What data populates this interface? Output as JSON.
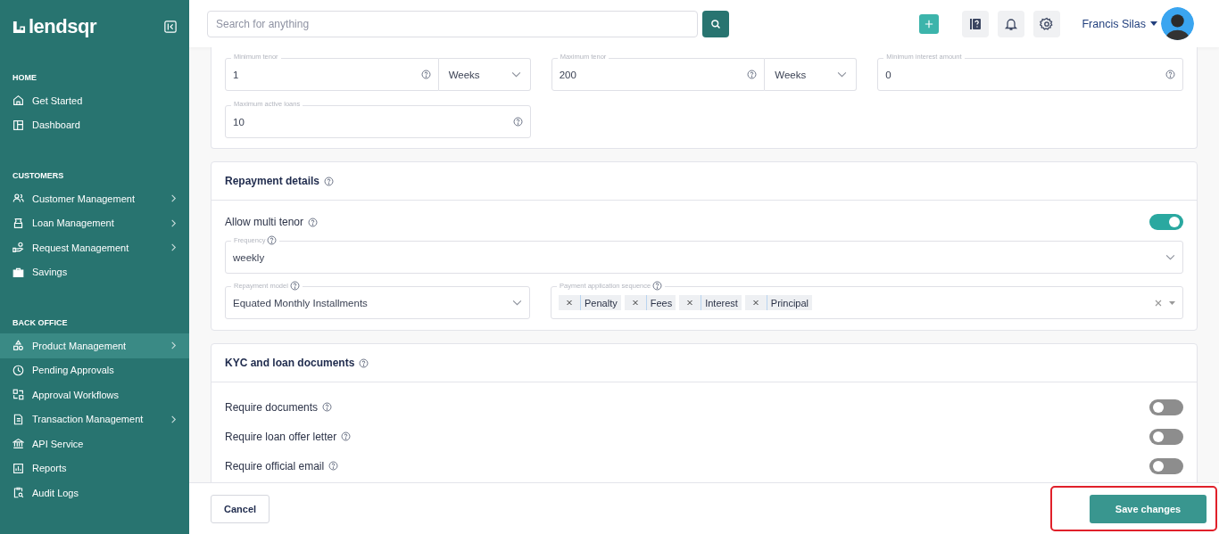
{
  "sidebar": {
    "logo": "lendsqr",
    "sections": [
      {
        "title": "HOME",
        "items": [
          {
            "label": "Get Started",
            "selected": false,
            "submenu": false
          },
          {
            "label": "Dashboard",
            "selected": false,
            "submenu": false
          }
        ]
      },
      {
        "title": "CUSTOMERS",
        "items": [
          {
            "label": "Customer Management",
            "selected": false,
            "submenu": true
          },
          {
            "label": "Loan Management",
            "selected": false,
            "submenu": true
          },
          {
            "label": "Request Management",
            "selected": false,
            "submenu": true
          },
          {
            "label": "Savings",
            "selected": false,
            "submenu": false
          }
        ]
      },
      {
        "title": "BACK OFFICE",
        "items": [
          {
            "label": "Product Management",
            "selected": true,
            "submenu": true
          },
          {
            "label": "Pending Approvals",
            "selected": false,
            "submenu": false
          },
          {
            "label": "Approval Workflows",
            "selected": false,
            "submenu": false
          },
          {
            "label": "Transaction Management",
            "selected": false,
            "submenu": true
          },
          {
            "label": "API Service",
            "selected": false,
            "submenu": false
          },
          {
            "label": "Reports",
            "selected": false,
            "submenu": false
          },
          {
            "label": "Audit Logs",
            "selected": false,
            "submenu": false
          }
        ]
      }
    ]
  },
  "topbar": {
    "search": {
      "placeholder": "Search for anything"
    },
    "user_name": "Francis Silas"
  },
  "limits": {
    "fields": [
      {
        "label": "Minimum tenor",
        "value": "1",
        "unit": "Weeks"
      },
      {
        "label": "Maximum tenor",
        "value": "200",
        "unit": "Weeks"
      },
      {
        "label": "Minimum interest amount",
        "value": "0"
      },
      {
        "label": "Maximum active loans",
        "value": "10"
      }
    ]
  },
  "repayment": {
    "title": "Repayment details",
    "multi_tenor": {
      "label": "Allow multi tenor",
      "on": true
    },
    "frequency": {
      "label": "Frequency",
      "value": "weekly"
    },
    "model": {
      "label": "Repayment model",
      "value": "Equated Monthly Installments"
    },
    "sequence": {
      "label": "Payment application sequence",
      "tags": [
        "Penalty",
        "Fees",
        "Interest",
        "Principal"
      ]
    }
  },
  "kyc": {
    "title": "KYC and loan documents",
    "rows": [
      {
        "label": "Require documents",
        "on": false
      },
      {
        "label": "Require loan offer letter",
        "on": false
      },
      {
        "label": "Require official email",
        "on": false
      }
    ]
  },
  "footer": {
    "cancel": "Cancel",
    "save": "Save changes",
    "save_highlighted": true
  }
}
